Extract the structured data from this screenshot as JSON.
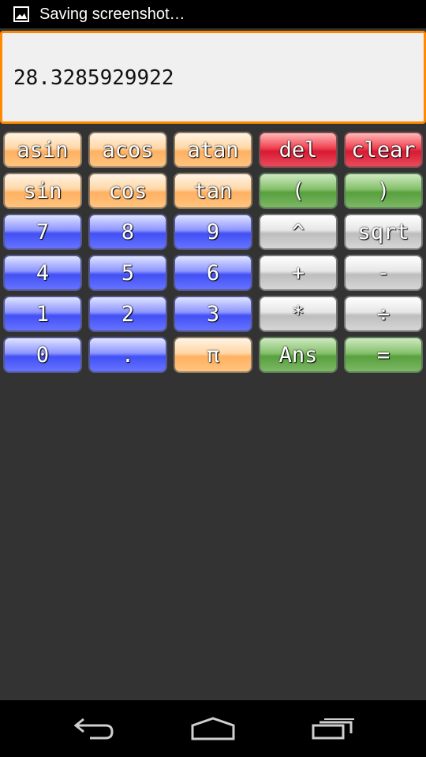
{
  "status_bar": {
    "notification_icon": "image-icon",
    "text": "Saving screenshot…"
  },
  "display": {
    "value": "28.3285929922"
  },
  "keypad": {
    "rows": [
      [
        {
          "label": "asin",
          "name": "asin-button",
          "color": "orange"
        },
        {
          "label": "acos",
          "name": "acos-button",
          "color": "orange"
        },
        {
          "label": "atan",
          "name": "atan-button",
          "color": "orange"
        },
        {
          "label": "del",
          "name": "del-button",
          "color": "red"
        },
        {
          "label": "clear",
          "name": "clear-button",
          "color": "red"
        }
      ],
      [
        {
          "label": "sin",
          "name": "sin-button",
          "color": "orange"
        },
        {
          "label": "cos",
          "name": "cos-button",
          "color": "orange"
        },
        {
          "label": "tan",
          "name": "tan-button",
          "color": "orange"
        },
        {
          "label": "(",
          "name": "open-paren-button",
          "color": "green"
        },
        {
          "label": ")",
          "name": "close-paren-button",
          "color": "green"
        }
      ],
      [
        {
          "label": "7",
          "name": "digit-7-button",
          "color": "blue"
        },
        {
          "label": "8",
          "name": "digit-8-button",
          "color": "blue"
        },
        {
          "label": "9",
          "name": "digit-9-button",
          "color": "blue"
        },
        {
          "label": "^",
          "name": "power-button",
          "color": "gray"
        },
        {
          "label": "sqrt",
          "name": "sqrt-button",
          "color": "gray"
        }
      ],
      [
        {
          "label": "4",
          "name": "digit-4-button",
          "color": "blue"
        },
        {
          "label": "5",
          "name": "digit-5-button",
          "color": "blue"
        },
        {
          "label": "6",
          "name": "digit-6-button",
          "color": "blue"
        },
        {
          "label": "+",
          "name": "plus-button",
          "color": "gray"
        },
        {
          "label": "-",
          "name": "minus-button",
          "color": "gray"
        }
      ],
      [
        {
          "label": "1",
          "name": "digit-1-button",
          "color": "blue"
        },
        {
          "label": "2",
          "name": "digit-2-button",
          "color": "blue"
        },
        {
          "label": "3",
          "name": "digit-3-button",
          "color": "blue"
        },
        {
          "label": "*",
          "name": "multiply-button",
          "color": "gray"
        },
        {
          "label": "÷",
          "name": "divide-button",
          "color": "gray"
        }
      ],
      [
        {
          "label": "0",
          "name": "digit-0-button",
          "color": "blue"
        },
        {
          "label": ".",
          "name": "decimal-button",
          "color": "blue"
        },
        {
          "label": "π",
          "name": "pi-button",
          "color": "orange"
        },
        {
          "label": "Ans",
          "name": "ans-button",
          "color": "green"
        },
        {
          "label": "=",
          "name": "equals-button",
          "color": "green"
        }
      ]
    ]
  },
  "nav_bar": {
    "back_icon": "back-icon",
    "home_icon": "home-icon",
    "recents_icon": "recent-apps-icon"
  },
  "colors": {
    "background": "#333333",
    "display_border": "#ff8a00",
    "display_bg": "#f0f0f0"
  }
}
